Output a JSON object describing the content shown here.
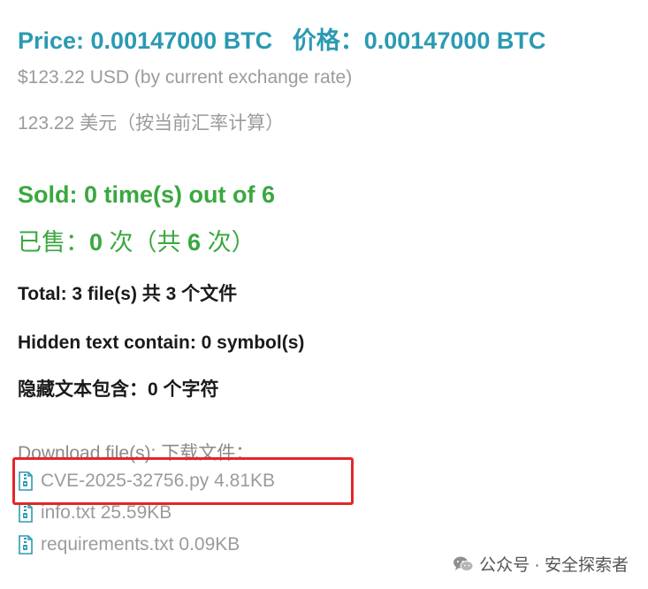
{
  "price": {
    "en": "Price: 0.00147000 BTC",
    "cn": "价格：0.00147000 BTC",
    "usd_en": "$123.22 USD (by current exchange rate)",
    "usd_cn": "123.22 美元（按当前汇率计算）"
  },
  "sold": {
    "en": "Sold: 0 time(s) out of 6",
    "cn_prefix": "已售：",
    "cn_count": "0",
    "cn_mid": " 次（共 ",
    "cn_total": "6",
    "cn_suffix": " 次）"
  },
  "total": "Total: 3 file(s)  共 3 个文件",
  "hidden": {
    "en": "Hidden text contain: 0 symbol(s)",
    "cn": "隐藏文本包含：0 个字符"
  },
  "downloads": {
    "label": "Download file(s):  下载文件：",
    "files": [
      {
        "name": "CVE-2025-32756.py",
        "size": "4.81KB"
      },
      {
        "name": "info.txt",
        "size": "25.59KB"
      },
      {
        "name": "requirements.txt",
        "size": "0.09KB"
      }
    ]
  },
  "watermark": "公众号 · 安全探索者",
  "icons": {
    "file": "zip-file-icon",
    "watermark": "wechat-icon"
  },
  "colors": {
    "price": "#2a9ab2",
    "sold": "#3aa83f",
    "muted": "#9b9b9b",
    "highlight": "#e3262b",
    "file_icon": "#2a9ab2"
  }
}
